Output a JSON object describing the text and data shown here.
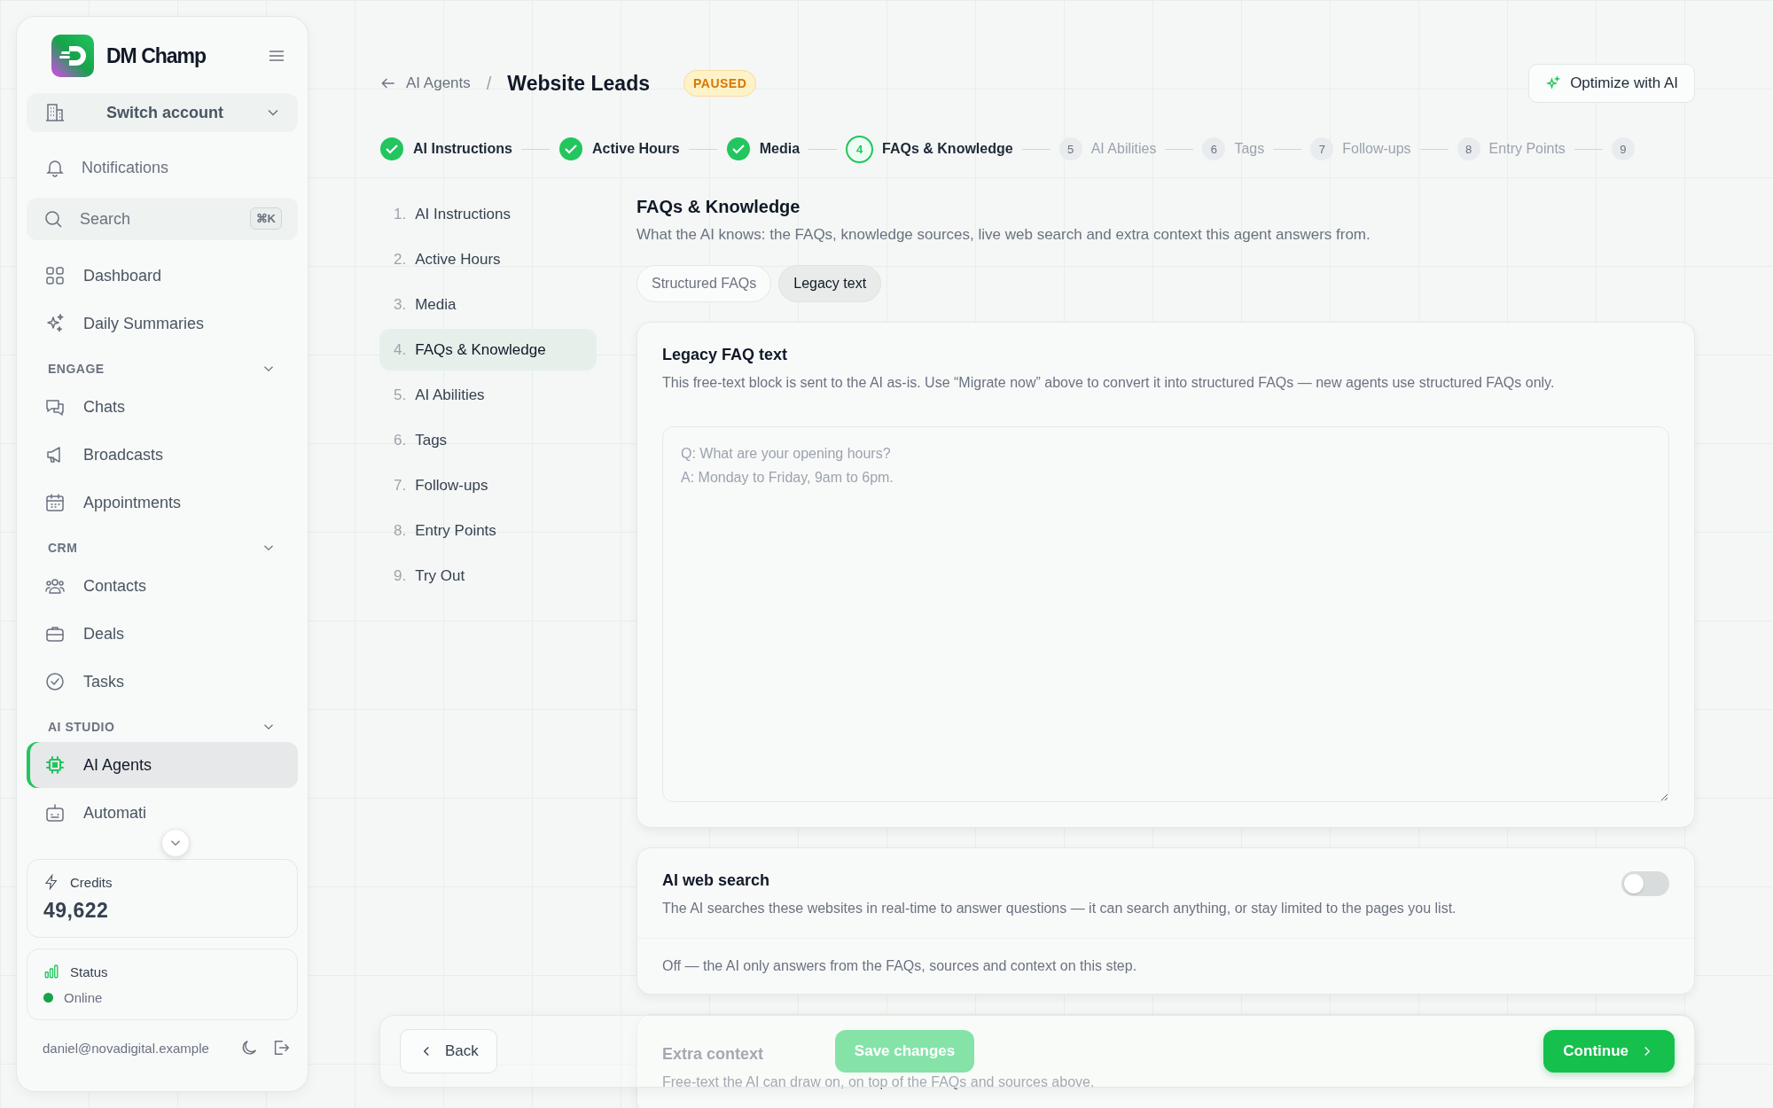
{
  "sidebar": {
    "brand": "DM Champ",
    "switch_account": "Switch account",
    "notifications": "Notifications",
    "search": {
      "placeholder": "Search",
      "shortcut": "⌘K"
    },
    "top_items": [
      {
        "label": "Dashboard",
        "selected": false
      },
      {
        "label": "Daily Summaries",
        "selected": false
      }
    ],
    "sections": [
      {
        "heading": "ENGAGE",
        "expanded": true,
        "items": [
          {
            "label": "Chats",
            "selected": false
          },
          {
            "label": "Broadcasts",
            "selected": false
          },
          {
            "label": "Appointments",
            "selected": false
          }
        ]
      },
      {
        "heading": "CRM",
        "expanded": true,
        "items": [
          {
            "label": "Contacts",
            "selected": false
          },
          {
            "label": "Deals",
            "selected": false
          },
          {
            "label": "Tasks",
            "selected": false
          }
        ]
      },
      {
        "heading": "AI STUDIO",
        "expanded": true,
        "items": [
          {
            "label": "AI Agents",
            "selected": true
          },
          {
            "label": "Automati",
            "selected": false
          }
        ]
      }
    ],
    "credits": {
      "label": "Credits",
      "value": "49,622"
    },
    "status": {
      "label": "Status",
      "value": "Online",
      "online": true
    },
    "user_email": "daniel@novadigital.example"
  },
  "header": {
    "back_label": "AI Agents",
    "separator": "/",
    "title": "Website Leads",
    "badge": "PAUSED",
    "optimize_button": "Optimize with AI"
  },
  "stepper": [
    {
      "label": "AI Instructions",
      "done": true,
      "selected": false
    },
    {
      "label": "Active Hours",
      "done": true,
      "selected": false
    },
    {
      "label": "Media",
      "done": true,
      "selected": false
    },
    {
      "number": "4",
      "label": "FAQs & Knowledge",
      "done": false,
      "selected": true
    },
    {
      "number": "5",
      "label": "AI Abilities",
      "done": false,
      "selected": false
    },
    {
      "number": "6",
      "label": "Tags",
      "done": false,
      "selected": false
    },
    {
      "number": "7",
      "label": "Follow-ups",
      "done": false,
      "selected": false
    },
    {
      "number": "8",
      "label": "Entry Points",
      "done": false,
      "selected": false
    },
    {
      "number": "9",
      "done": false,
      "selected": false
    }
  ],
  "step_list": [
    {
      "number": "1.",
      "label": "AI Instructions",
      "selected": false
    },
    {
      "number": "2.",
      "label": "Active Hours",
      "selected": false
    },
    {
      "number": "3.",
      "label": "Media",
      "selected": false
    },
    {
      "number": "4.",
      "label": "FAQs & Knowledge",
      "selected": true
    },
    {
      "number": "5.",
      "label": "AI Abilities",
      "selected": false
    },
    {
      "number": "6.",
      "label": "Tags",
      "selected": false
    },
    {
      "number": "7.",
      "label": "Follow-ups",
      "selected": false
    },
    {
      "number": "8.",
      "label": "Entry Points",
      "selected": false
    },
    {
      "number": "9.",
      "label": "Try Out",
      "selected": false
    }
  ],
  "section": {
    "title": "FAQs & Knowledge",
    "description": "What the AI knows: the FAQs, knowledge sources, live web search and extra context this agent answers from.",
    "tabs": [
      {
        "label": "Structured FAQs",
        "selected": false
      },
      {
        "label": "Legacy text",
        "selected": true
      }
    ]
  },
  "legacy_card": {
    "title": "Legacy FAQ text",
    "description": "This free-text block is sent to the AI as-is. Use “Migrate now” above to convert it into structured FAQs — new agents use structured FAQs only.",
    "placeholder": "Q: What are your opening hours?\nA: Monday to Friday, 9am to 6pm."
  },
  "web_search_card": {
    "title": "AI web search",
    "description": "The AI searches these websites in real-time to answer questions — it can search anything, or stay limited to the pages you list.",
    "enabled": false,
    "note": "Off — the AI only answers from the FAQs, sources and context on this step."
  },
  "extra_context_card": {
    "title": "Extra context",
    "description": "Free-text the AI can draw on, on top of the FAQs and sources above."
  },
  "footer": {
    "back_button": "Back",
    "save_button": {
      "label": "Save changes",
      "disabled": true
    },
    "continue_button": "Continue"
  }
}
